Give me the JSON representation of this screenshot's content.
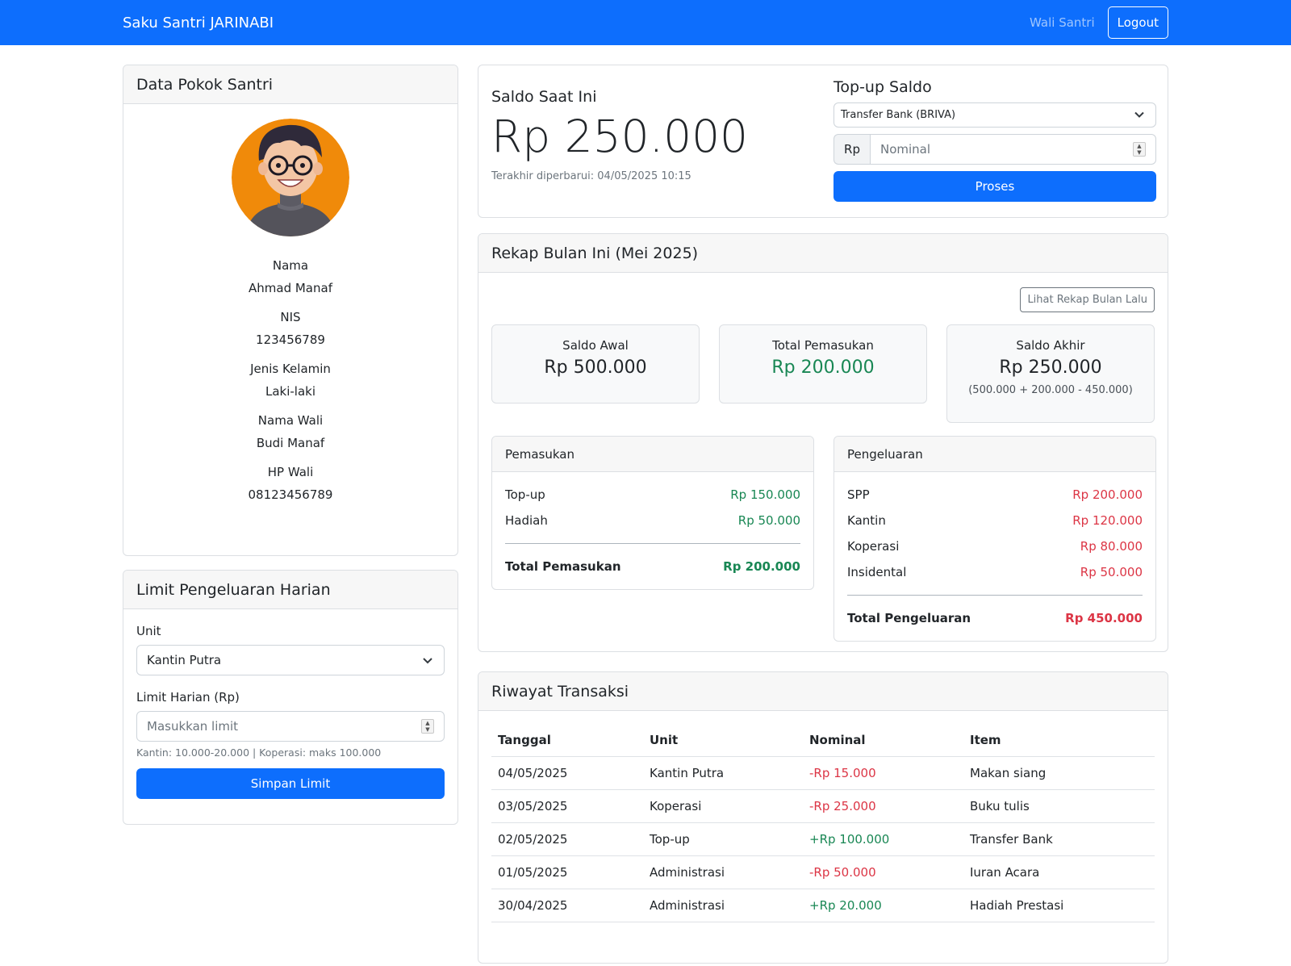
{
  "navbar": {
    "brand": "Saku Santri JARINABI",
    "role": "Wali Santri",
    "logout": "Logout"
  },
  "profile": {
    "title": "Data Pokok Santri",
    "fields": [
      {
        "label": "Nama",
        "value": "Ahmad Manaf"
      },
      {
        "label": "NIS",
        "value": "123456789"
      },
      {
        "label": "Jenis Kelamin",
        "value": "Laki-laki"
      },
      {
        "label": "Nama Wali",
        "value": "Budi Manaf"
      },
      {
        "label": "HP Wali",
        "value": "08123456789"
      }
    ]
  },
  "limit": {
    "title": "Limit Pengeluaran Harian",
    "unit_label": "Unit",
    "unit_value": "Kantin Putra",
    "limit_label": "Limit Harian (Rp)",
    "limit_placeholder": "Masukkan limit",
    "hint": "Kantin: 10.000-20.000 | Koperasi: maks 100.000",
    "button": "Simpan Limit"
  },
  "saldo": {
    "title": "Saldo Saat Ini",
    "amount": "Rp 250.000",
    "updated": "Terakhir diperbarui: 04/05/2025 10:15"
  },
  "topup": {
    "title": "Top-up Saldo",
    "method": "Transfer Bank (BRIVA)",
    "prefix": "Rp",
    "nominal_placeholder": "Nominal",
    "button": "Proses"
  },
  "rekap": {
    "title": "Rekap Bulan Ini (Mei 2025)",
    "prev_button": "Lihat Rekap Bulan Lalu",
    "saldo_awal": {
      "label": "Saldo Awal",
      "value": "Rp 500.000"
    },
    "total_pemasukan": {
      "label": "Total Pemasukan",
      "value": "Rp 200.000"
    },
    "saldo_akhir": {
      "label": "Saldo Akhir",
      "value": "Rp 250.000",
      "note": "(500.000 + 200.000 - 450.000)"
    },
    "pemasukan": {
      "title": "Pemasukan",
      "items": [
        {
          "name": "Top-up",
          "amount": "Rp 150.000"
        },
        {
          "name": "Hadiah",
          "amount": "Rp 50.000"
        }
      ],
      "total_label": "Total Pemasukan",
      "total": "Rp 200.000"
    },
    "pengeluaran": {
      "title": "Pengeluaran",
      "items": [
        {
          "name": "SPP",
          "amount": "Rp 200.000"
        },
        {
          "name": "Kantin",
          "amount": "Rp 120.000"
        },
        {
          "name": "Koperasi",
          "amount": "Rp 80.000"
        },
        {
          "name": "Insidental",
          "amount": "Rp 50.000"
        }
      ],
      "total_label": "Total Pengeluaran",
      "total": "Rp 450.000"
    }
  },
  "riwayat": {
    "title": "Riwayat Transaksi",
    "headers": [
      "Tanggal",
      "Unit",
      "Nominal",
      "Item"
    ],
    "rows": [
      {
        "date": "04/05/2025",
        "unit": "Kantin Putra",
        "nominal": "-Rp 15.000",
        "item": "Makan siang",
        "type": "out"
      },
      {
        "date": "03/05/2025",
        "unit": "Koperasi",
        "nominal": "-Rp 25.000",
        "item": "Buku tulis",
        "type": "out"
      },
      {
        "date": "02/05/2025",
        "unit": "Top-up",
        "nominal": "+Rp 100.000",
        "item": "Transfer Bank",
        "type": "in"
      },
      {
        "date": "01/05/2025",
        "unit": "Administrasi",
        "nominal": "-Rp 50.000",
        "item": "Iuran Acara",
        "type": "out"
      },
      {
        "date": "30/04/2025",
        "unit": "Administrasi",
        "nominal": "+Rp 20.000",
        "item": "Hadiah Prestasi",
        "type": "in"
      }
    ]
  },
  "colors": {
    "primary": "#0d6efd",
    "income": "#198754",
    "expense": "#dc3545"
  },
  "icons": {
    "avatar": "student-avatar-icon",
    "chevron": "chevron-down-icon",
    "spinner": "number-spinner-icon"
  }
}
